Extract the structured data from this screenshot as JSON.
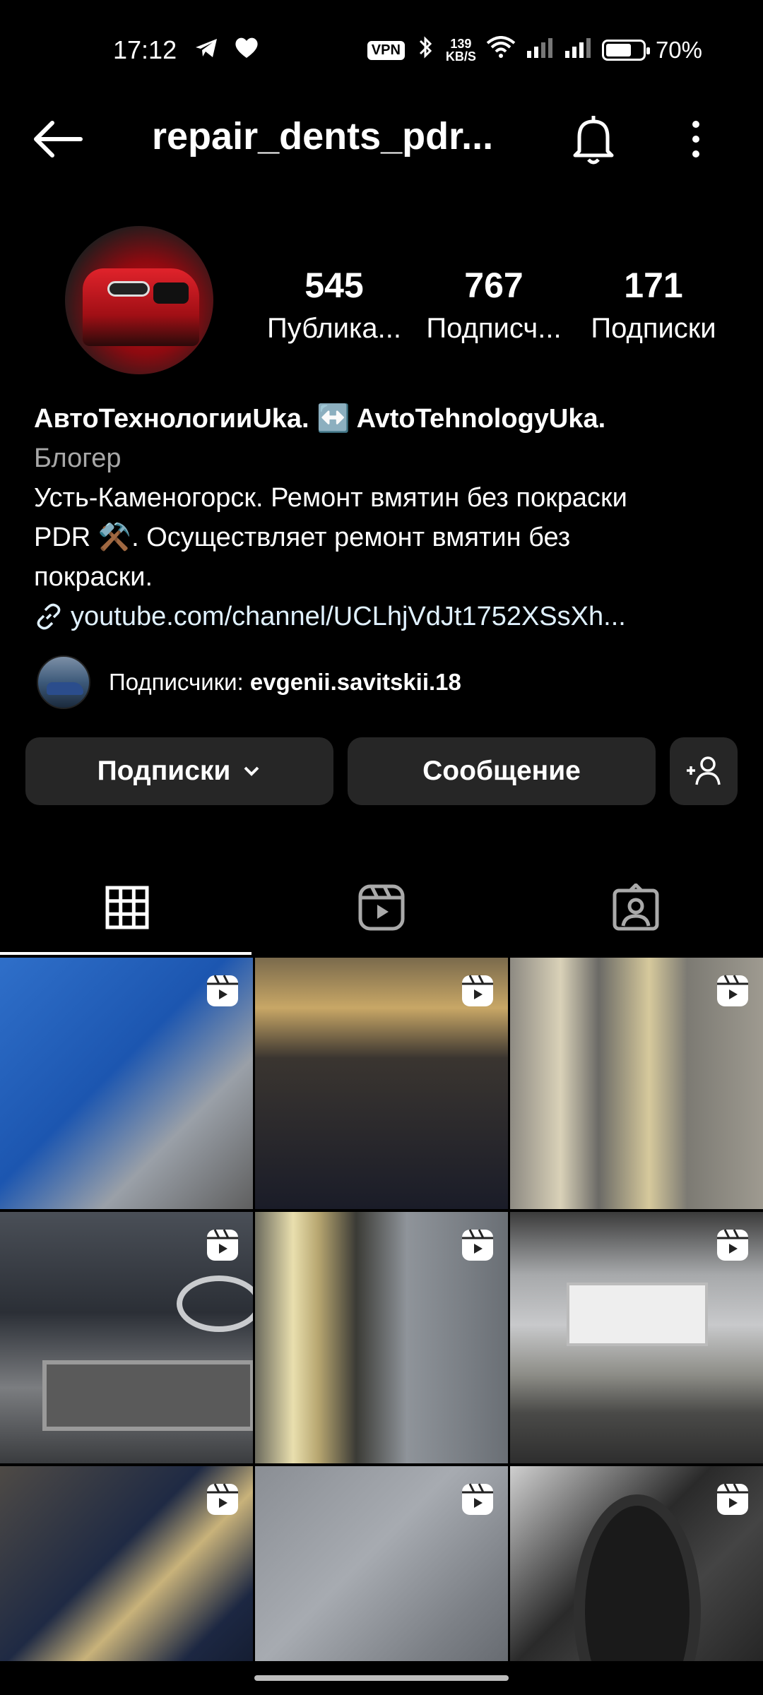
{
  "status_bar": {
    "time": "17:12",
    "vpn": "VPN",
    "net_speed_value": "139",
    "net_speed_unit": "KB/S",
    "battery": "70%",
    "battery_level": 0.7
  },
  "header": {
    "username": "repair_dents_pdr..."
  },
  "profile": {
    "stats": [
      {
        "value": "545",
        "label": "Публика..."
      },
      {
        "value": "767",
        "label": "Подписч..."
      },
      {
        "value": "171",
        "label": "Подписки"
      }
    ],
    "name": "АвтоТехнологииUka. ↔️ AvtoTehnologyUka.",
    "category": "Блогер",
    "bio_line1": "Усть-Каменогорск. Ремонт вмятин без покраски",
    "bio_line2": "PDR ⚒️.  Осуществляет ремонт вмятин без",
    "bio_line3": "покраски.",
    "link": "youtube.com/channel/UCLhjVdJt1752XSsXh..."
  },
  "followers": {
    "prefix": "Подписчики: ",
    "name": "evgenii.savitskii.18"
  },
  "actions": {
    "following": "Подписки",
    "message": "Сообщение"
  },
  "tabs": [
    {
      "name": "grid-icon",
      "active": true
    },
    {
      "name": "reels-icon",
      "active": false
    },
    {
      "name": "tagged-icon",
      "active": false
    }
  ],
  "grid_posts": [
    {
      "type": "reel",
      "icon": "reel-icon"
    },
    {
      "type": "reel",
      "icon": "reel-icon"
    },
    {
      "type": "reel",
      "icon": "reel-icon"
    },
    {
      "type": "reel",
      "icon": "reel-icon"
    },
    {
      "type": "reel",
      "icon": "reel-icon"
    },
    {
      "type": "reel",
      "icon": "reel-icon"
    },
    {
      "type": "reel",
      "icon": "reel-icon"
    },
    {
      "type": "reel",
      "icon": "reel-icon"
    },
    {
      "type": "reel",
      "icon": "reel-icon"
    }
  ]
}
